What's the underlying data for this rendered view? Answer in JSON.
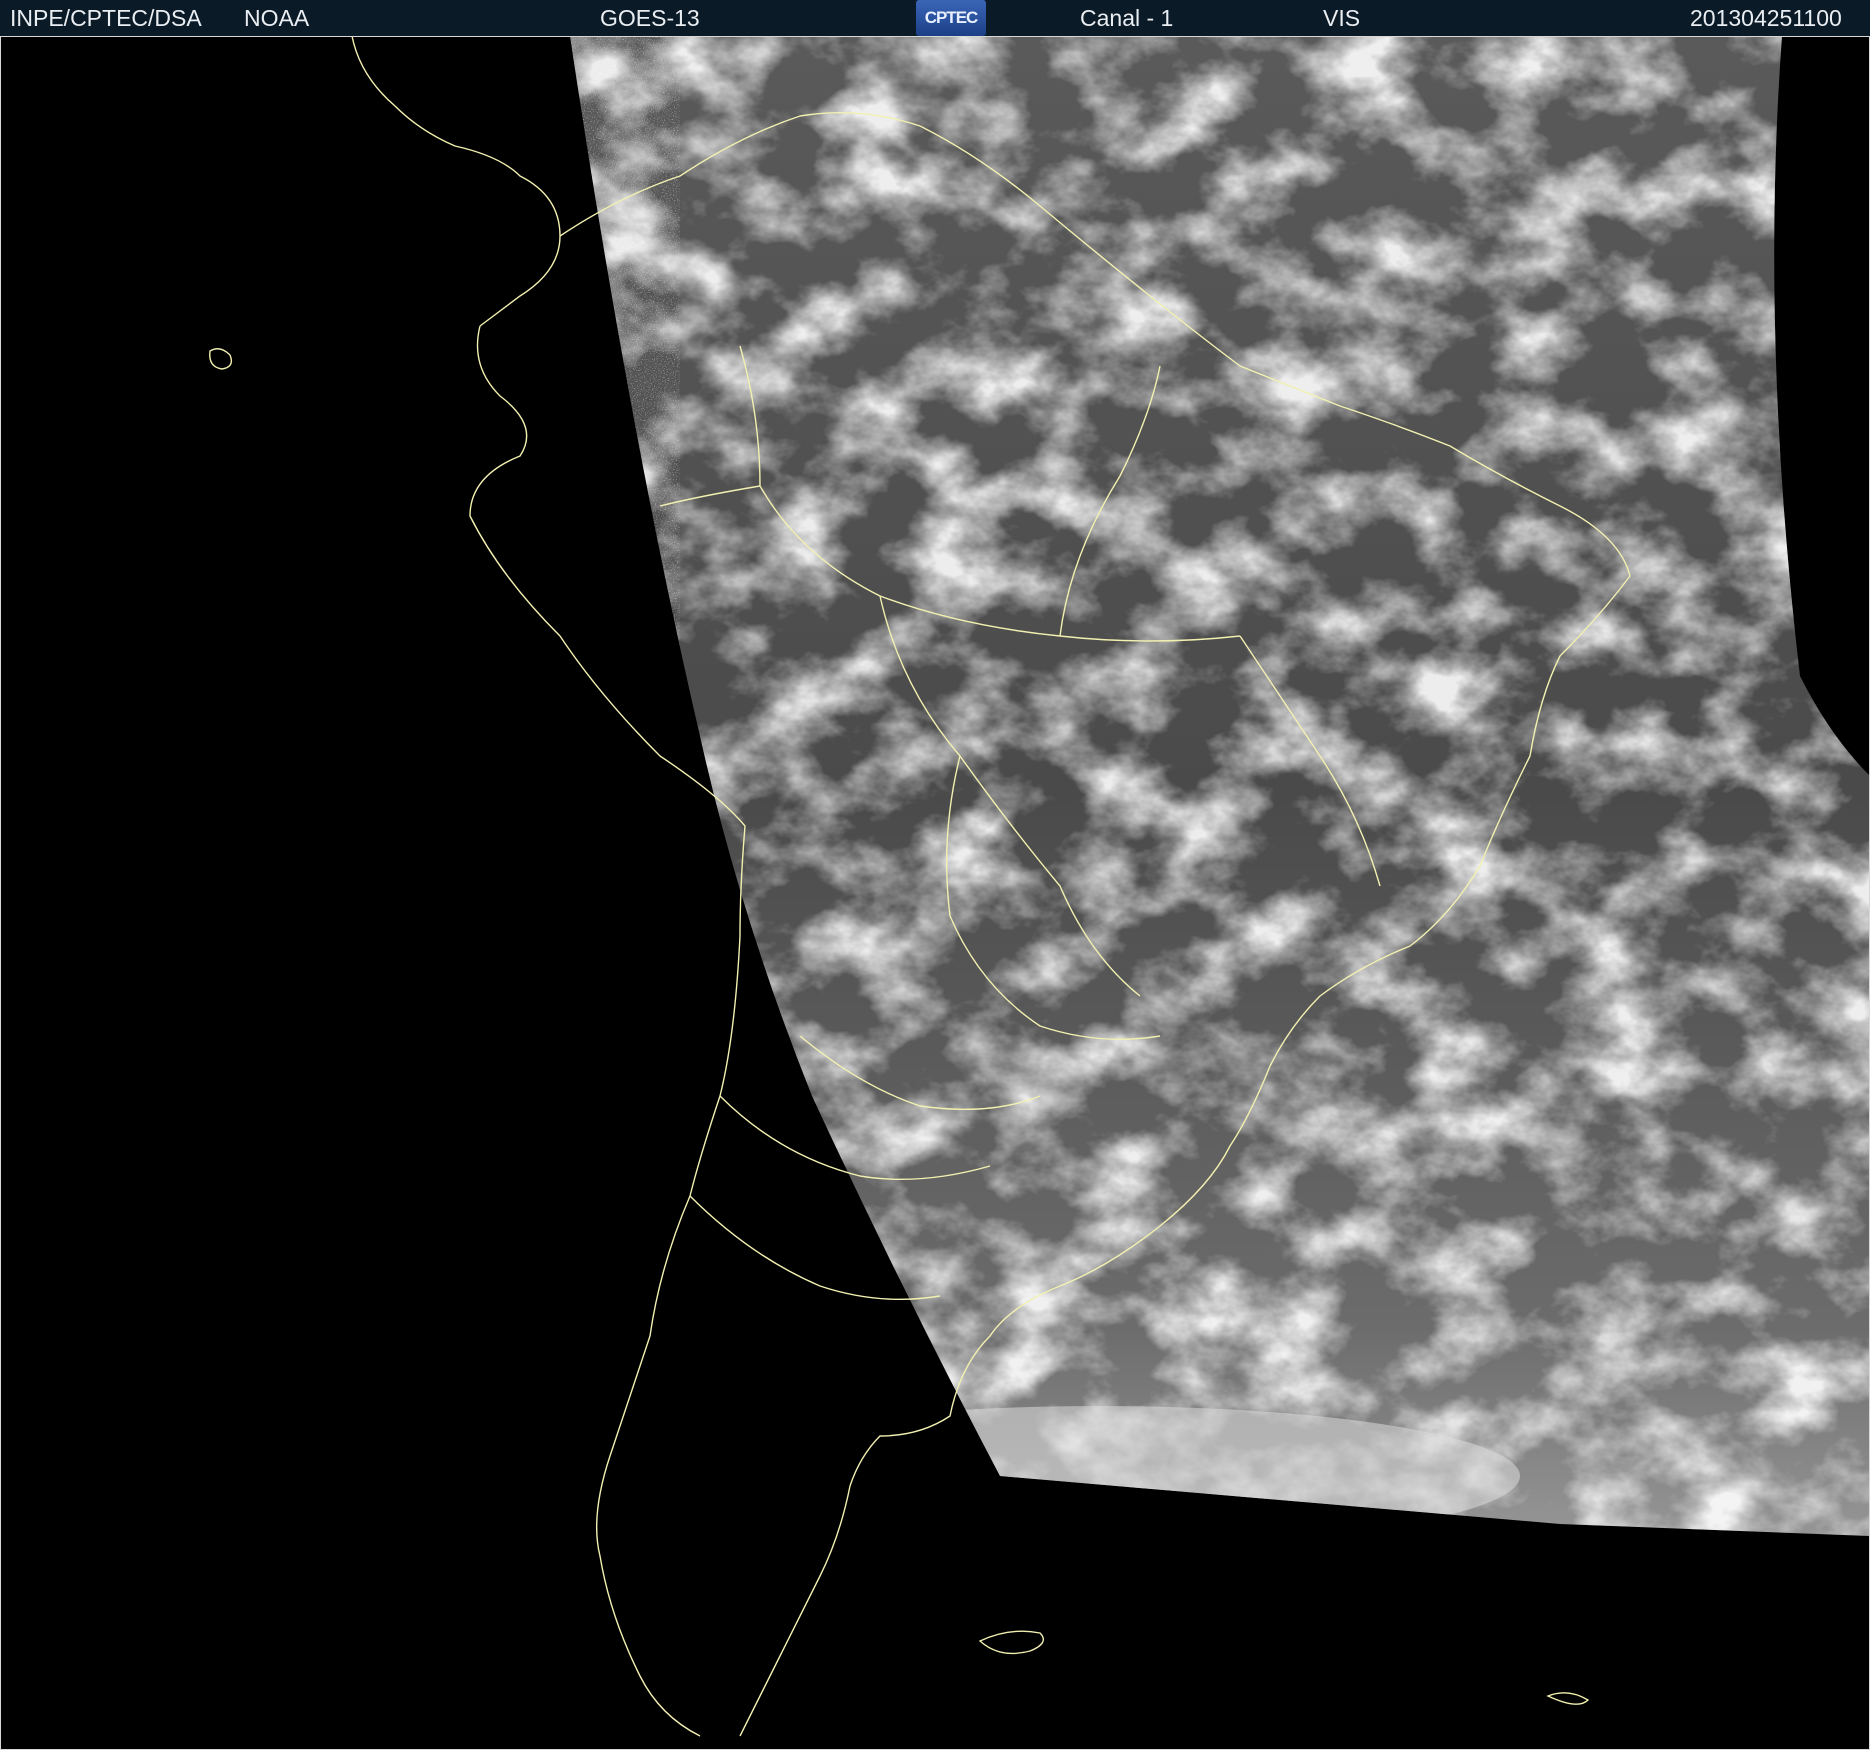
{
  "header": {
    "org": "INPE/CPTEC/DSA",
    "agency": "NOAA",
    "satellite": "GOES-13",
    "logo_text": "CPTEC",
    "channel": "Canal - 1",
    "band": "VIS",
    "timestamp": "201304251100"
  },
  "colors": {
    "header_bg": "#0b1a27",
    "header_text": "#e9eef2",
    "coastline": "#f2f0b0",
    "background": "#000000"
  }
}
